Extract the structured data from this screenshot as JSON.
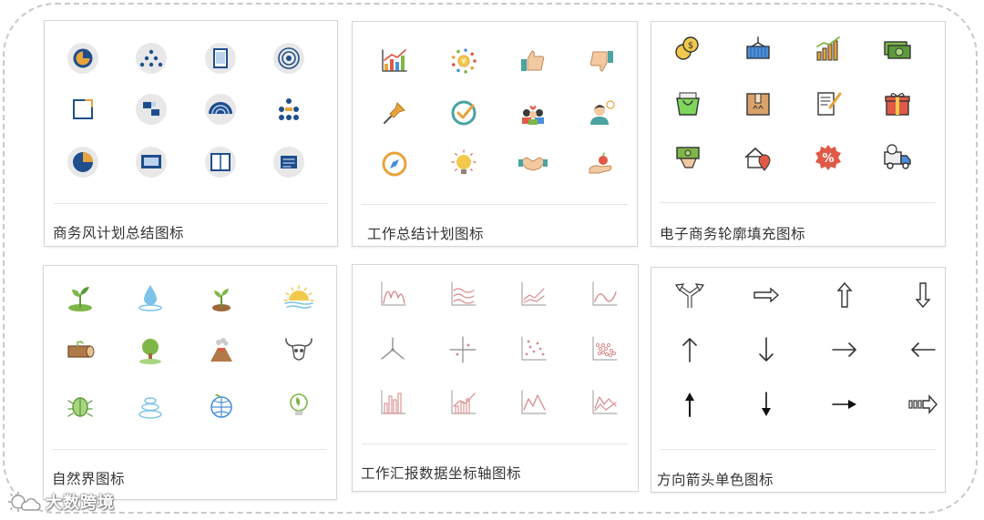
{
  "cards": [
    {
      "caption": "商务风计划总结图标",
      "style": "business",
      "icons": [
        "pie-target-icon",
        "dots-pyramid-icon",
        "tablet-icon",
        "concentric-circles-icon",
        "square-corner-icon",
        "blocks-icon",
        "radar-icon",
        "org-chart-icon",
        "pie-chart-icon",
        "presentation-board-icon",
        "book-icon",
        "document-stack-icon"
      ]
    },
    {
      "caption": "工作总结计划图标",
      "style": "work",
      "icons": [
        "bar-growth-chart-icon",
        "coin-cycle-icon",
        "thumbs-up-icon",
        "thumbs-down-icon",
        "pushpin-icon",
        "check-badge-icon",
        "team-heart-icon",
        "person-idea-icon",
        "compass-icon",
        "light-bulb-icon",
        "handshake-icon",
        "hand-apple-icon"
      ]
    },
    {
      "caption": "电子商务轮廓填充图标",
      "style": "ecommerce",
      "icons": [
        "coin-stack-icon",
        "shipping-container-icon",
        "growth-bars-icon",
        "banknotes-icon",
        "shopping-bag-icon",
        "package-box-icon",
        "invoice-pen-icon",
        "gift-icon",
        "cash-hand-icon",
        "house-location-icon",
        "discount-badge-icon",
        "delivery-truck-icon"
      ]
    },
    {
      "caption": "自然界图标",
      "style": "nature",
      "icons": [
        "sprout-icon",
        "water-drop-icon",
        "seedling-icon",
        "sunrise-icon",
        "log-icon",
        "tree-icon",
        "volcano-icon",
        "bull-skull-icon",
        "beetle-icon",
        "stones-icon",
        "globe-plant-icon",
        "eco-bulb-icon"
      ]
    },
    {
      "caption": "工作汇报数据坐标轴图标",
      "style": "axis",
      "icons": [
        "axis-curve-icon",
        "axis-waves-icon",
        "axis-lines-icon",
        "axis-line-icon",
        "axis-3d-icon",
        "axis-cross-icon",
        "axis-scatter-icon",
        "axis-scatter-dense-icon",
        "axis-bars-icon",
        "axis-bar-line-icon",
        "axis-zigzag-icon",
        "axis-double-line-icon"
      ]
    },
    {
      "caption": "方向箭头单色图标",
      "style": "arrows",
      "icons": [
        "split-arrow-icon",
        "right-hollow-arrow-icon",
        "up-hollow-arrow-icon",
        "down-hollow-arrow-icon",
        "up-arrow-icon",
        "down-arrow-icon",
        "right-arrow-icon",
        "left-arrow-icon",
        "up-bold-arrow-icon",
        "down-dotted-arrow-icon",
        "right-dashed-arrow-icon",
        "right-striped-arrow-icon"
      ]
    }
  ],
  "watermark": {
    "text": "大数跨境",
    "icon": "sun-cloud-icon"
  }
}
